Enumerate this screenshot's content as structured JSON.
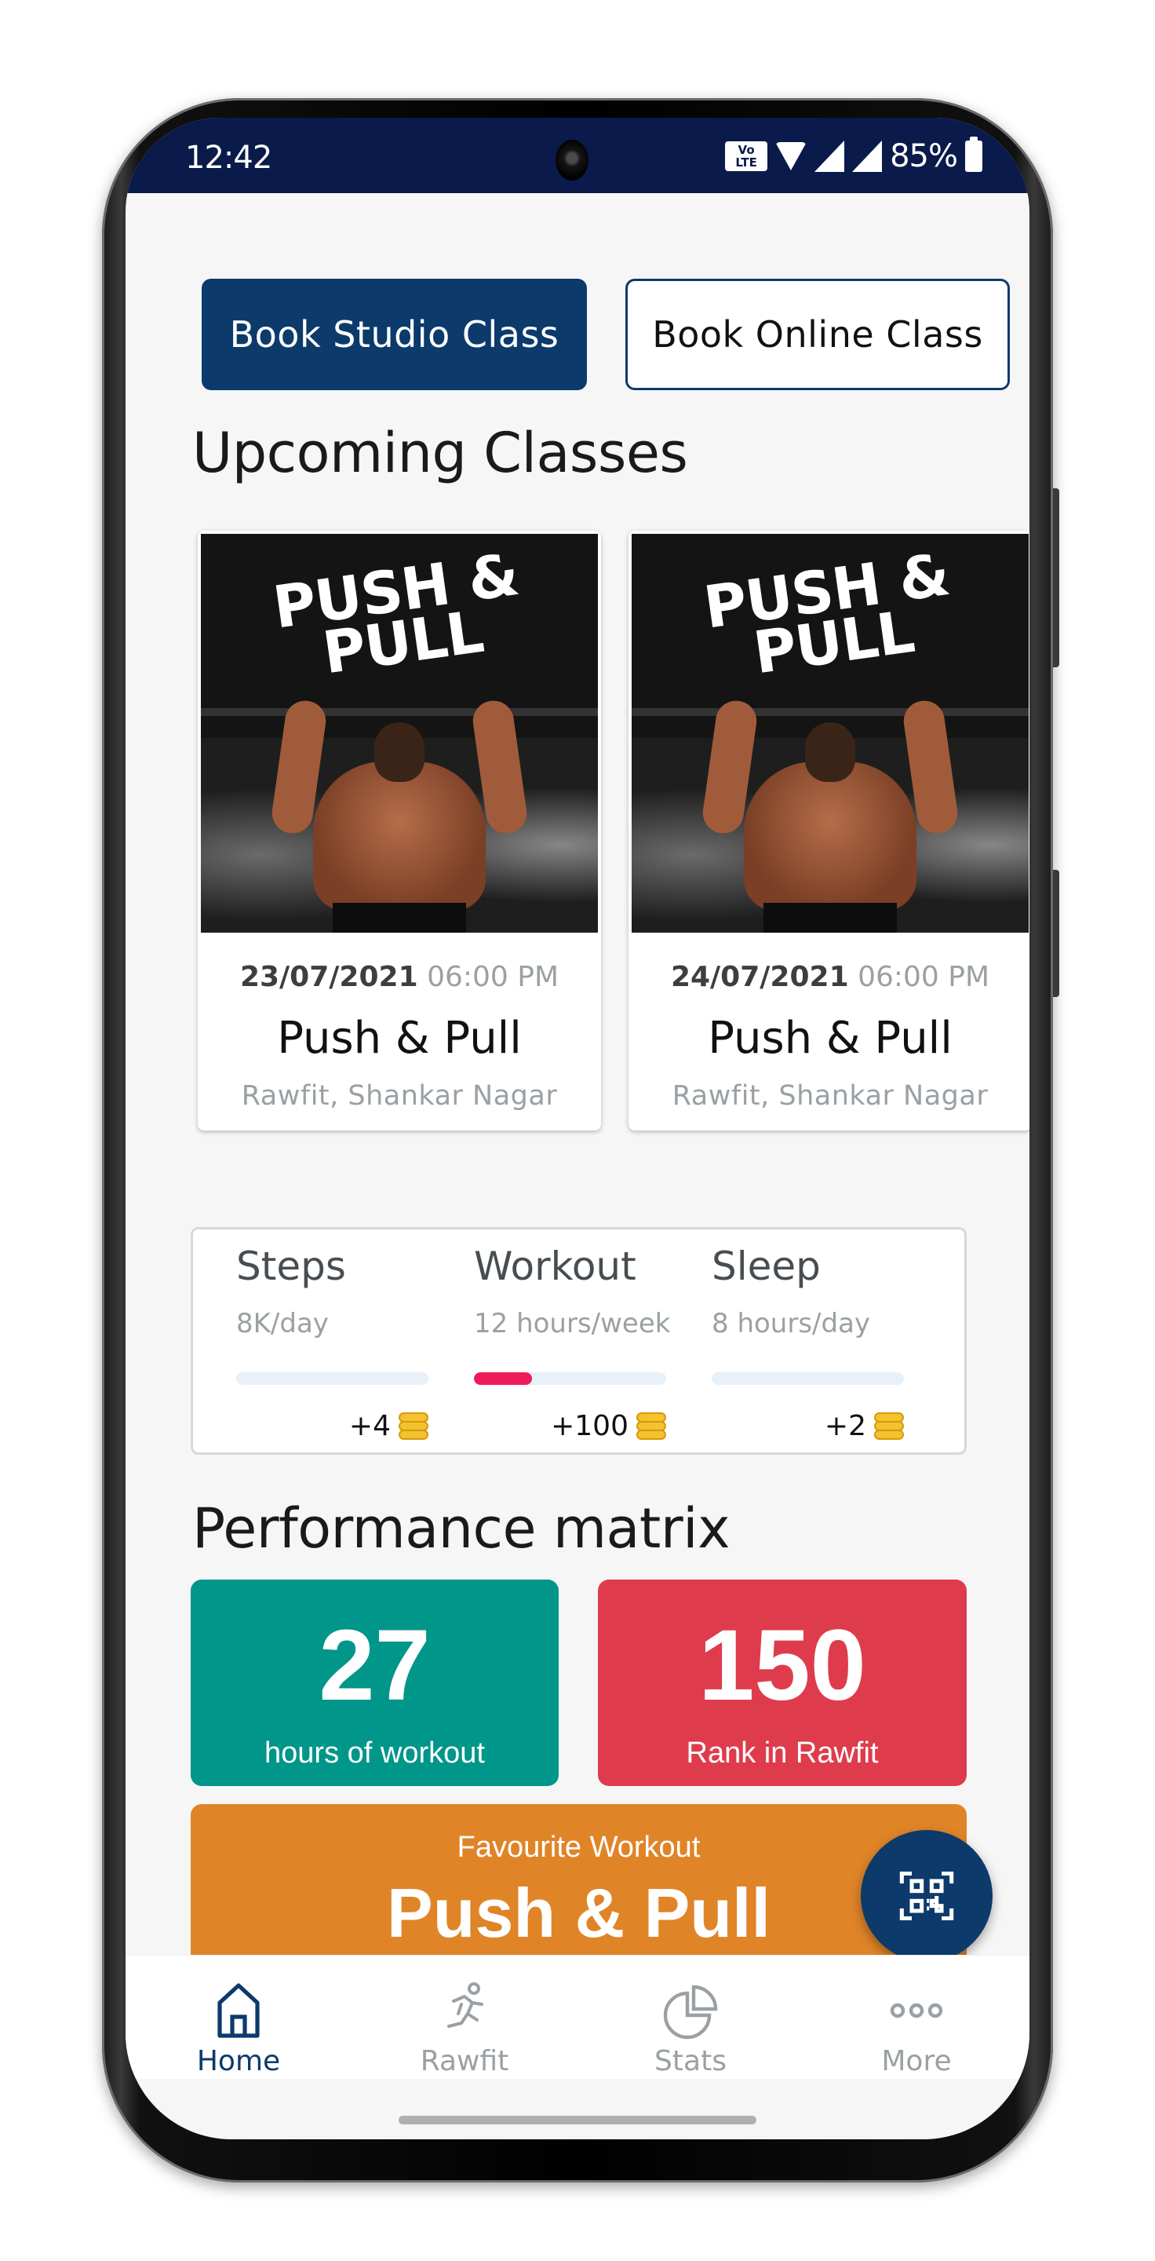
{
  "status_bar": {
    "time": "12:42",
    "network_badge": "Vo LTE 1",
    "battery": "85%",
    "icons": [
      "volte-icon",
      "wifi-icon",
      "signal-icon",
      "signal-icon",
      "battery-icon"
    ]
  },
  "actions": {
    "book_studio": "Book Studio Class",
    "book_online": "Book Online Class"
  },
  "upcoming": {
    "title": "Upcoming Classes",
    "classes": [
      {
        "poster_line1": "PUSH &",
        "poster_line2": "PULL",
        "date": "23/07/2021",
        "time": "06:00 PM",
        "name": "Push & Pull",
        "location": "Rawfit, Shankar Nagar"
      },
      {
        "poster_line1": "PUSH &",
        "poster_line2": "PULL",
        "date": "24/07/2021",
        "time": "06:00 PM",
        "name": "Push & Pull",
        "location": "Rawfit, Shankar Nagar"
      }
    ]
  },
  "goals": [
    {
      "name": "Steps",
      "target": "8K/day",
      "progress": 0,
      "reward": "+4"
    },
    {
      "name": "Workout",
      "target": "12 hours/week",
      "progress": 0.3,
      "reward": "+100"
    },
    {
      "name": "Sleep",
      "target": "8 hours/day",
      "progress": 0,
      "reward": "+2"
    }
  ],
  "performance": {
    "title": "Performance matrix",
    "hours": {
      "value": "27",
      "label": "hours of workout",
      "color": "#00968a"
    },
    "rank": {
      "value": "150",
      "label": "Rank in Rawfit",
      "color": "#de3c4c"
    },
    "favourite": {
      "label": "Favourite Workout",
      "value": "Push & Pull",
      "color": "#e08428"
    }
  },
  "fab": {
    "icon": "qr-scan-icon"
  },
  "nav": {
    "items": [
      {
        "label": "Home",
        "icon": "home-icon",
        "active": true
      },
      {
        "label": "Rawfit",
        "icon": "running-icon",
        "active": false
      },
      {
        "label": "Stats",
        "icon": "pie-chart-icon",
        "active": false
      },
      {
        "label": "More",
        "icon": "more-icon",
        "active": false
      }
    ]
  },
  "colors": {
    "primary": "#0c3a6b",
    "status_bar": "#0a1a4a",
    "progress": "#f0195a"
  }
}
